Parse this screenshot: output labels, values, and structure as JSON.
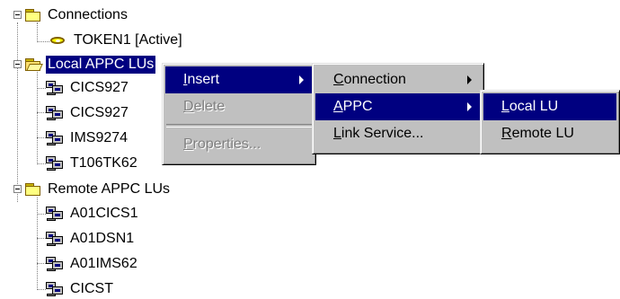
{
  "tree": {
    "connections_folder": "Connections",
    "token_item": "TOKEN1  [Active]",
    "local_folder": "Local APPC LUs",
    "local_items": [
      "CICS927",
      "CICS927",
      "IMS9274",
      "T106TK62"
    ],
    "remote_folder": "Remote APPC LUs",
    "remote_items": [
      "A01CICS1",
      "A01DSN1",
      "A01IMS62",
      "CICST"
    ]
  },
  "context_menu": {
    "insert": {
      "pre": "",
      "key": "I",
      "post": "nsert"
    },
    "delete": {
      "pre": "",
      "key": "D",
      "post": "elete"
    },
    "properties": {
      "pre": "",
      "key": "P",
      "post": "roperties..."
    }
  },
  "insert_submenu": {
    "connection": {
      "pre": "",
      "key": "C",
      "post": "onnection"
    },
    "appc": {
      "pre": "",
      "key": "A",
      "post": "PPC"
    },
    "link_service": {
      "pre": "",
      "key": "L",
      "post": "ink Service..."
    }
  },
  "appc_submenu": {
    "local_lu": {
      "pre": "",
      "key": "L",
      "post": "ocal LU"
    },
    "remote_lu": {
      "pre": "",
      "key": "R",
      "post": "emote LU"
    }
  },
  "colors": {
    "highlight": "#000080",
    "menu_face": "#c0c0c0"
  }
}
